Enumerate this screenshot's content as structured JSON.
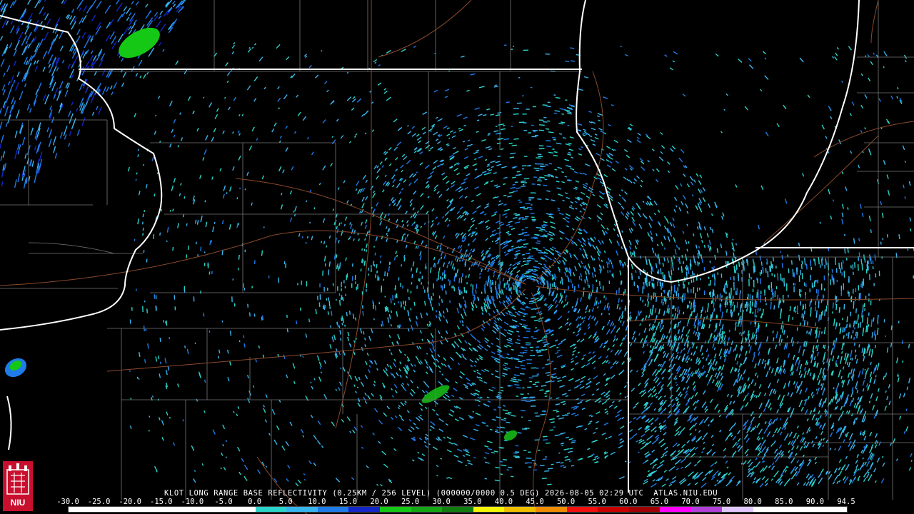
{
  "footer": {
    "title": "KLOT LONG RANGE BASE REFLECTIVITY (0.25KM / 256 LEVEL) (000000/0000 0.5 DEG) 2026-08-05 02:29 UTC  ATLAS.NIU.EDU"
  },
  "scale": {
    "labels": [
      "-30.0",
      "-25.0",
      "-20.0",
      "-15.0",
      "-10.0",
      "-5.0",
      "0.0",
      "5.0",
      "10.0",
      "15.0",
      "20.0",
      "25.0",
      "30.0",
      "35.0",
      "40.0",
      "45.0",
      "50.0",
      "55.0",
      "60.0",
      "65.0",
      "70.0",
      "75.0",
      "80.0",
      "85.0",
      "90.0",
      "94.5"
    ],
    "colors": [
      "#ffffff",
      "#ffffff",
      "#ffffff",
      "#ffffff",
      "#ffffff",
      "#ffffff",
      "#2bd4c8",
      "#39b5ee",
      "#1e7be8",
      "#1426c8",
      "#15c815",
      "#15a615",
      "#0f7d0f",
      "#f5f50a",
      "#f0c000",
      "#f08c00",
      "#f01010",
      "#c80000",
      "#a00000",
      "#ff00ff",
      "#b040d8",
      "#e0c8ff",
      "#ffffff",
      "#ffffff",
      "#ffffff"
    ]
  },
  "logo": {
    "text": "NIU",
    "bg_color": "#c8102e"
  }
}
